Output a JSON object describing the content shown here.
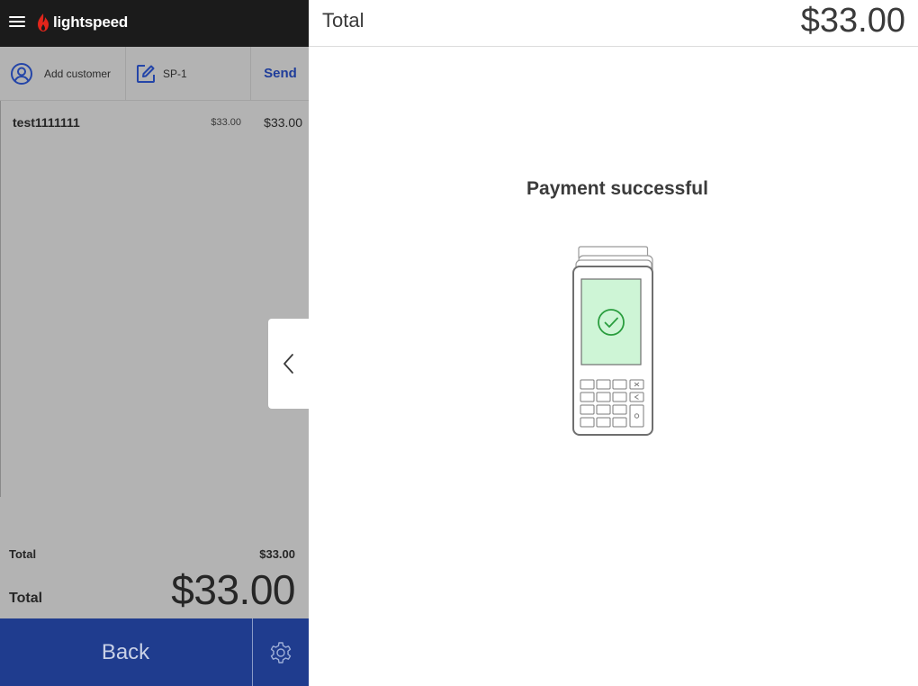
{
  "header": {
    "logo_text": "lightspeed",
    "brand_color": "#e1251b"
  },
  "actions": {
    "add_customer": "Add customer",
    "sale_reference": "SP-1",
    "send": "Send"
  },
  "line_items": [
    {
      "name": "test1111111",
      "unit_price": "$33.00",
      "total": "$33.00"
    }
  ],
  "totals": {
    "subtotal_label": "Total",
    "subtotal_value": "$33.00",
    "grand_label": "Total",
    "grand_value": "$33.00"
  },
  "footer": {
    "back": "Back",
    "accent": "#1f3c8e"
  },
  "payment": {
    "header_label": "Total",
    "header_value": "$33.00",
    "status": "Payment successful",
    "success_color": "#2a9d3e"
  },
  "icons": {
    "menu": "hamburger-icon",
    "customer": "user-circle-icon",
    "reference": "edit-icon",
    "settings": "gear-icon",
    "collapse": "chevron-left-icon",
    "terminal": "card-terminal-icon",
    "success": "check-circle-icon"
  }
}
